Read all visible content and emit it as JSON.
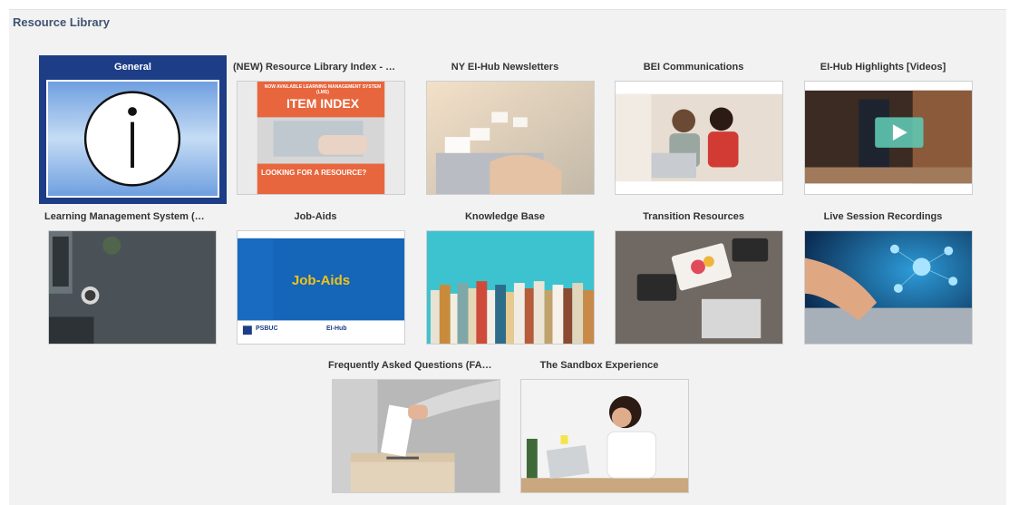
{
  "page": {
    "title": "Resource Library"
  },
  "tiles": [
    {
      "label": "General"
    },
    {
      "label": "(NEW) Resource Library Index - Quick ..."
    },
    {
      "label": "NY EI-Hub Newsletters"
    },
    {
      "label": "BEI Communications"
    },
    {
      "label": "EI-Hub Highlights [Videos]"
    },
    {
      "label": "Learning Management System (LMS) ..."
    },
    {
      "label": "Job-Aids"
    },
    {
      "label": "Knowledge Base"
    },
    {
      "label": "Transition Resources"
    },
    {
      "label": "Live Session Recordings"
    },
    {
      "label": "Frequently Asked Questions (FAQs)"
    },
    {
      "label": "The Sandbox Experience"
    }
  ],
  "item_index_card": {
    "tagline": "NOW AVAILABLE LEARNING MANAGEMENT SYSTEM (LMS)",
    "heading": "ITEM INDEX",
    "question": "LOOKING FOR A RESOURCE?"
  },
  "job_aids_card": {
    "heading": "Job-Aids",
    "logo_left": "PSBUC",
    "logo_right": "EI-Hub"
  },
  "colors": {
    "selected_tile": "#1d3e86",
    "title_text": "#3f5372",
    "panel_bg": "#f2f2f2"
  }
}
